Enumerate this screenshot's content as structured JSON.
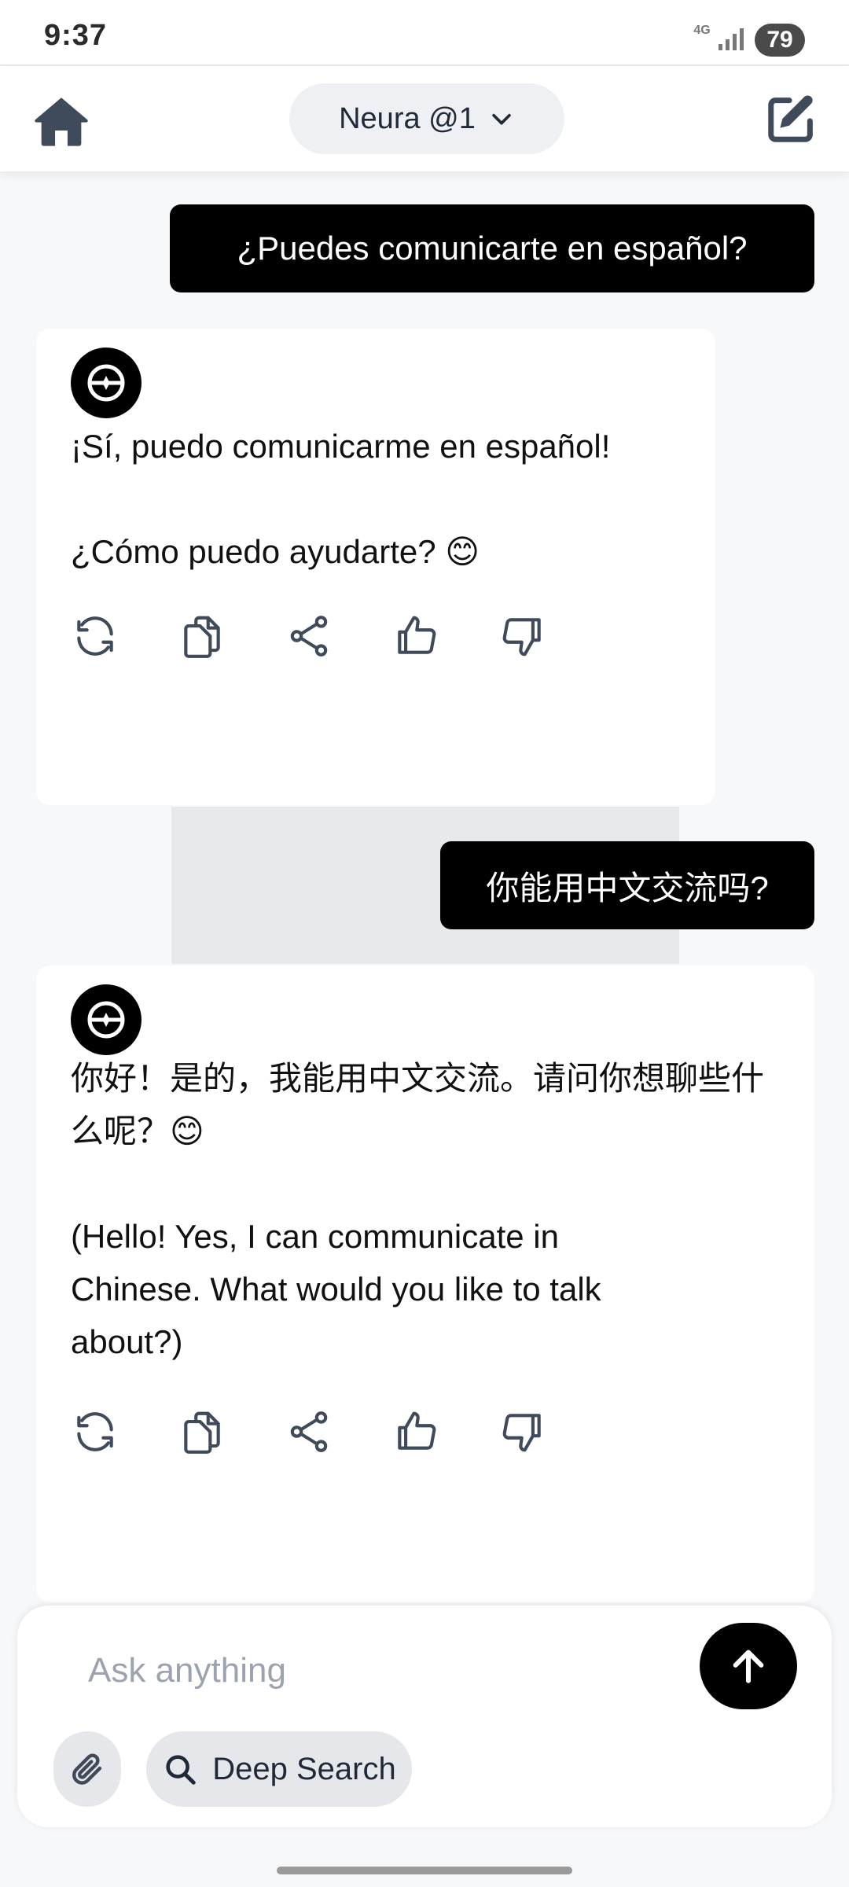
{
  "status_bar": {
    "time": "9:37",
    "network": "4G",
    "battery": "79"
  },
  "header": {
    "model_label": "Neura @1",
    "home_icon": "home-icon",
    "model_chevron_icon": "chevron-down-icon",
    "new_chat_icon": "edit-icon"
  },
  "messages": [
    {
      "role": "user",
      "text": "¿Puedes comunicarte en español?"
    },
    {
      "role": "assistant",
      "text": "¡Sí, puedo comunicarme en español!\n\n¿Cómo puedo ayudarte? 😊"
    },
    {
      "role": "user",
      "text": "你能用中文交流吗?"
    },
    {
      "role": "assistant",
      "text": "你好！是的，我能用中文交流。请问你想聊些什\n么呢？😊\n\n(Hello! Yes, I can communicate in\nChinese. What would you like to talk\nabout?)"
    }
  ],
  "message_actions": [
    "refresh-icon",
    "copy-icon",
    "share-icon",
    "thumbs-up-icon",
    "thumbs-down-icon"
  ],
  "composer": {
    "placeholder": "Ask anything",
    "value": "",
    "deep_search_label": "Deep Search",
    "send_icon": "arrow-up-icon",
    "attach_icon": "paperclip-icon",
    "search_icon": "search-icon"
  },
  "colors": {
    "background": "#f7f8fa",
    "user_bubble": "#000000",
    "assistant_card": "#ffffff",
    "accent": "#000000",
    "chip_bg": "#e5e7eb"
  }
}
